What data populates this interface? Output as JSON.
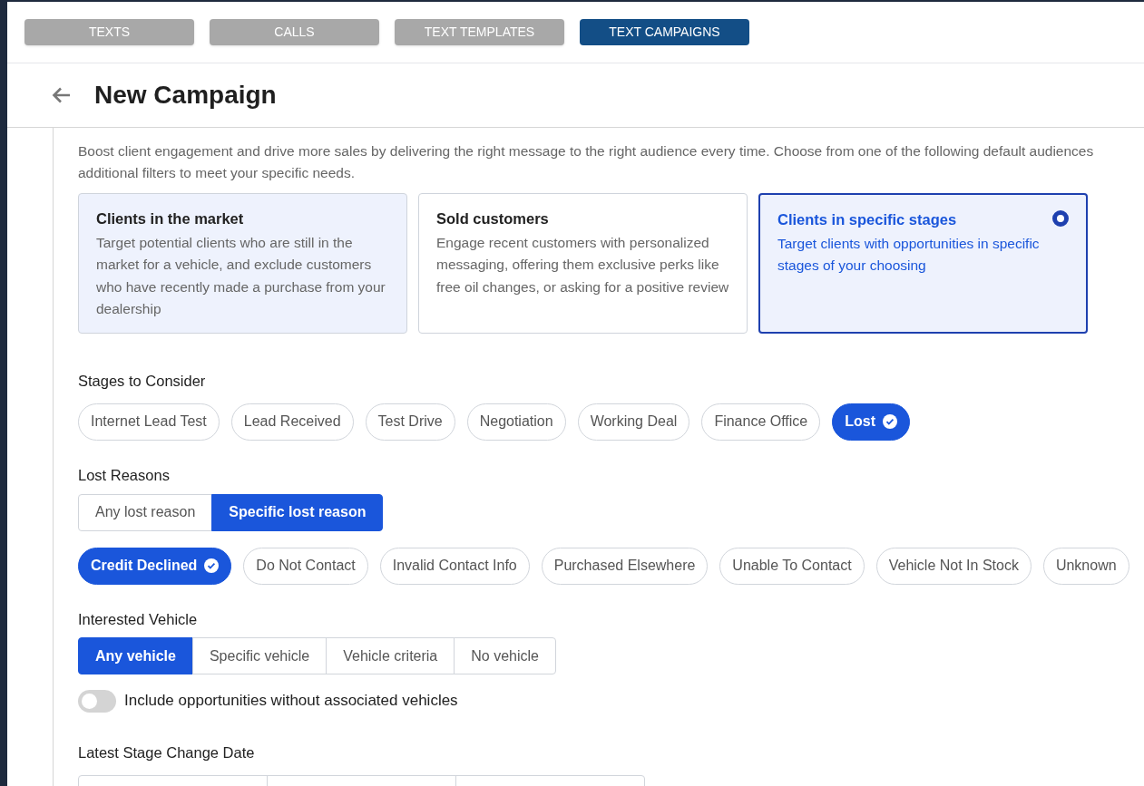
{
  "tabs": [
    {
      "label": "TEXTS",
      "selected": false
    },
    {
      "label": "CALLS",
      "selected": false
    },
    {
      "label": "TEXT TEMPLATES",
      "selected": false
    },
    {
      "label": "TEXT CAMPAIGNS",
      "selected": true
    }
  ],
  "page_title": "New Campaign",
  "audience": {
    "description_lines": [
      "Boost client engagement and drive more sales by delivering the right message to the right audience every time. Choose from one of the following default audiences",
      "additional filters to meet your specific needs."
    ],
    "options": [
      {
        "title": "Clients in the market",
        "description": "Target potential clients who are still in the market for a vehicle, and exclude customers who have recently made a purchase from your dealership",
        "selected": false,
        "tinted": true
      },
      {
        "title": "Sold customers",
        "description": "Engage recent customers with personalized messaging, offering them exclusive perks like free oil changes, or asking for a positive review",
        "selected": false,
        "tinted": false
      },
      {
        "title": "Clients in specific stages",
        "description": "Target clients with opportunities in specific stages of your choosing",
        "selected": true,
        "tinted": true
      }
    ]
  },
  "stages": {
    "label": "Stages to Consider",
    "chips": [
      {
        "label": "Internet Lead Test",
        "selected": false
      },
      {
        "label": "Lead Received",
        "selected": false
      },
      {
        "label": "Test Drive",
        "selected": false
      },
      {
        "label": "Negotiation",
        "selected": false
      },
      {
        "label": "Working Deal",
        "selected": false
      },
      {
        "label": "Finance Office",
        "selected": false
      },
      {
        "label": "Lost",
        "selected": true
      }
    ]
  },
  "lost_reasons": {
    "label": "Lost Reasons",
    "modes": [
      {
        "label": "Any lost reason",
        "selected": false
      },
      {
        "label": "Specific lost reason",
        "selected": true
      }
    ],
    "chips": [
      {
        "label": "Credit Declined",
        "selected": true
      },
      {
        "label": "Do Not Contact",
        "selected": false
      },
      {
        "label": "Invalid Contact Info",
        "selected": false
      },
      {
        "label": "Purchased Elsewhere",
        "selected": false
      },
      {
        "label": "Unable To Contact",
        "selected": false
      },
      {
        "label": "Vehicle Not In Stock",
        "selected": false
      },
      {
        "label": "Unknown",
        "selected": false
      }
    ]
  },
  "interested_vehicle": {
    "label": "Interested Vehicle",
    "modes": [
      {
        "label": "Any vehicle",
        "selected": true
      },
      {
        "label": "Specific vehicle",
        "selected": false
      },
      {
        "label": "Vehicle criteria",
        "selected": false
      },
      {
        "label": "No vehicle",
        "selected": false
      }
    ],
    "toggle": {
      "label": "Include opportunities without associated vehicles",
      "on": false
    }
  },
  "stage_change_date": {
    "label": "Latest Stage Change Date"
  }
}
